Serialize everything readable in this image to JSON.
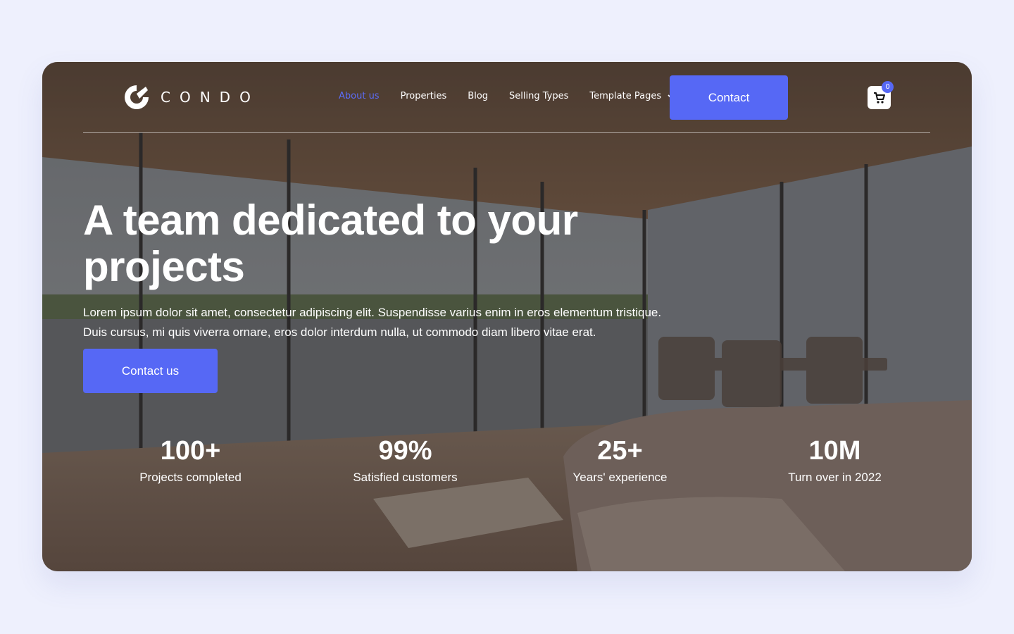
{
  "brand": {
    "name": "CONDO",
    "logo_icon": "condo-logo-icon"
  },
  "nav": {
    "items": [
      {
        "label": "About us",
        "active": true
      },
      {
        "label": "Properties",
        "active": false
      },
      {
        "label": "Blog",
        "active": false
      },
      {
        "label": "Selling Types",
        "active": false
      }
    ],
    "dropdown": {
      "label": "Template Pages",
      "icon": "chevron-down-icon"
    },
    "contact_label": "Contact"
  },
  "cart": {
    "count": "0",
    "icon": "cart-icon"
  },
  "hero": {
    "title": "A team dedicated to your projects",
    "text": "Lorem ipsum dolor sit amet, consectetur adipiscing elit. Suspendisse varius enim in eros elementum tristique. Duis cursus, mi quis viverra ornare, eros dolor interdum nulla, ut commodo diam libero vitae erat.",
    "cta_label": "Contact us"
  },
  "stats": [
    {
      "value": "100+",
      "label": "Projects completed"
    },
    {
      "value": "99%",
      "label": "Satisfied customers"
    },
    {
      "value": "25+",
      "label": "Years' experience"
    },
    {
      "value": "10M",
      "label": "Turn over in 2022"
    }
  ],
  "colors": {
    "accent": "#5668f5",
    "page_bg": "#eef0fd",
    "text_on_image": "#ffffff"
  }
}
